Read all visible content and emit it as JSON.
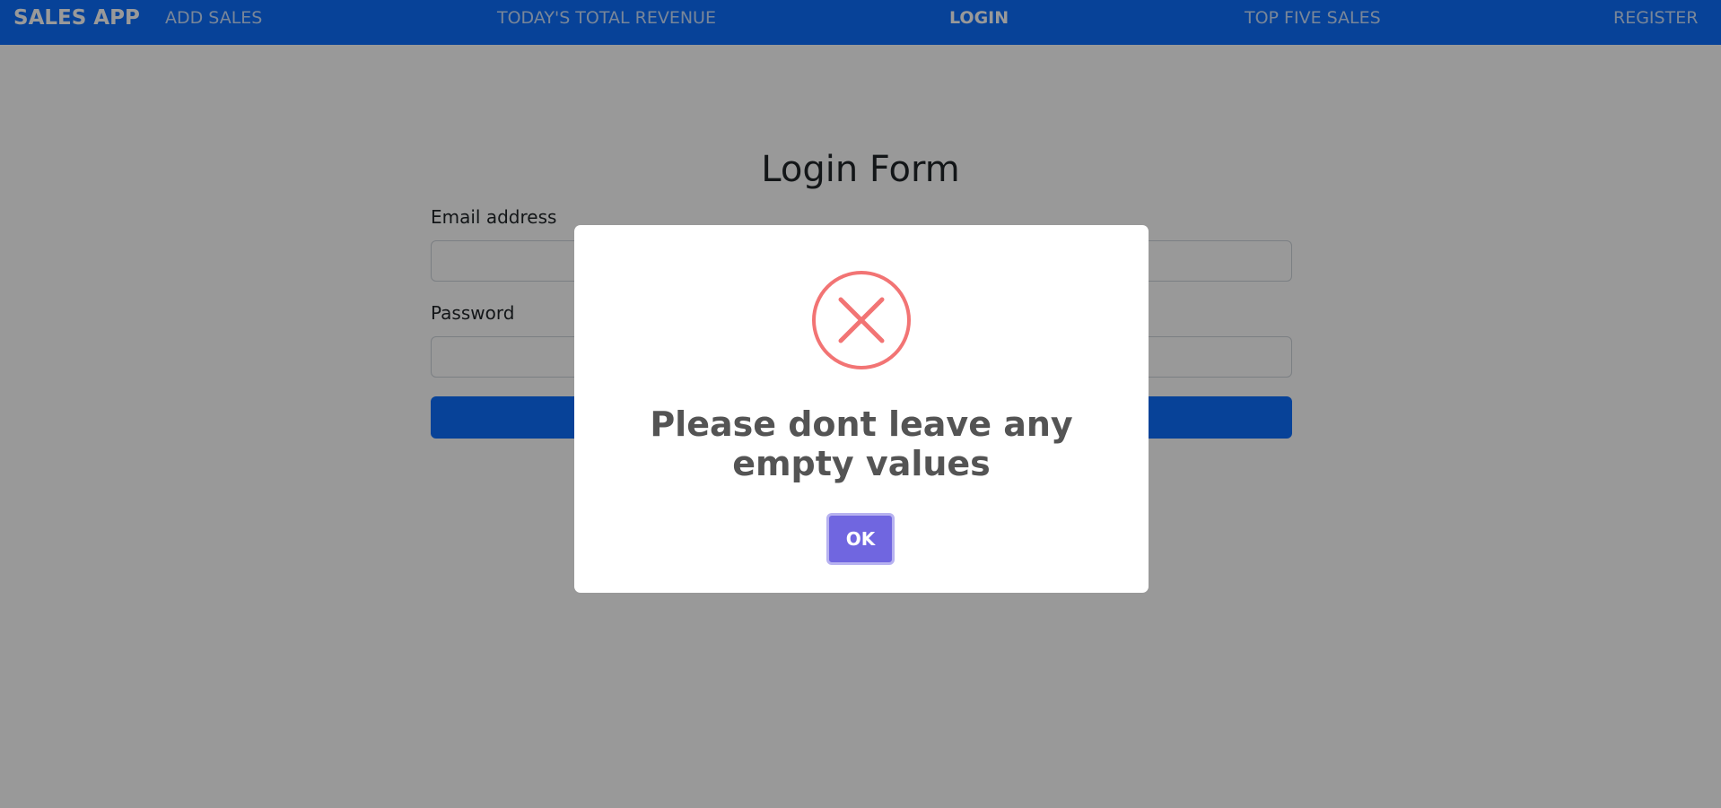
{
  "navbar": {
    "brand": "SALES APP",
    "items": [
      {
        "label": "ADD SALES"
      },
      {
        "label": "TODAY'S TOTAL REVENUE"
      },
      {
        "label": "LOGIN",
        "active": true
      },
      {
        "label": "TOP FIVE SALES"
      },
      {
        "label": "REGISTER"
      }
    ]
  },
  "form": {
    "title": "Login Form",
    "email_label": "Email address",
    "email_value": "",
    "password_label": "Password",
    "password_value": ""
  },
  "modal": {
    "icon": "error-x-icon",
    "message": "Please dont leave any empty values",
    "ok_label": "OK"
  },
  "colors": {
    "primary": "#0d6efd",
    "confirm_button": "#7066e0",
    "error_icon": "#f27474",
    "overlay": "rgba(0,0,0,0.4)"
  }
}
